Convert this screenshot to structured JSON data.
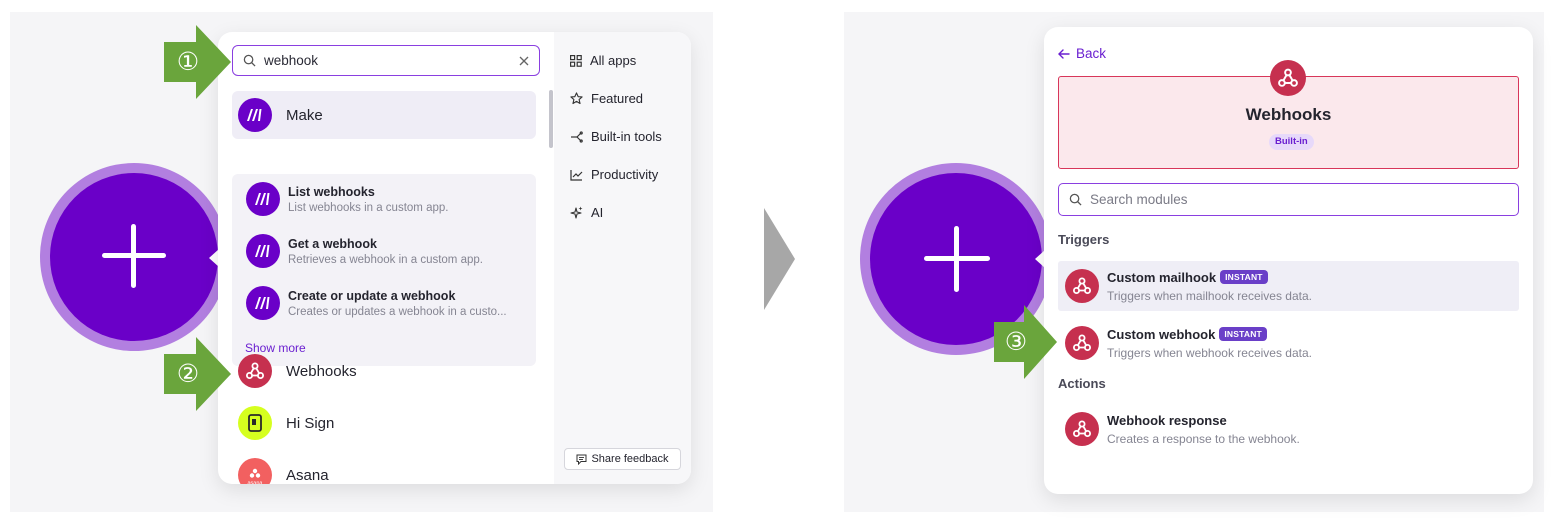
{
  "left": {
    "search": {
      "value": "webhook",
      "clear_icon": "close-icon"
    },
    "apps": [
      {
        "name": "Make",
        "icon": "make-logo-icon"
      },
      {
        "name": "Webhooks",
        "icon": "webhook-icon"
      },
      {
        "name": "Hi Sign",
        "icon": "hi-sign-logo-icon"
      },
      {
        "name": "Asana",
        "icon": "asana-logo-icon",
        "logo_text": "asana"
      }
    ],
    "make_modules": [
      {
        "title": "List webhooks",
        "desc": "List webhooks in a custom app."
      },
      {
        "title": "Get a webhook",
        "desc": "Retrieves a webhook in a custom app."
      },
      {
        "title": "Create or update a webhook",
        "desc": "Creates or updates a webhook in a custo..."
      }
    ],
    "show_more": "Show more",
    "sidebar": [
      {
        "label": "All apps",
        "icon": "grid-icon"
      },
      {
        "label": "Featured",
        "icon": "star-icon"
      },
      {
        "label": "Built-in tools",
        "icon": "tools-icon"
      },
      {
        "label": "Productivity",
        "icon": "chart-icon"
      },
      {
        "label": "AI",
        "icon": "sparkle-icon"
      }
    ],
    "feedback": "Share feedback"
  },
  "callouts": [
    "①",
    "②",
    "③"
  ],
  "right": {
    "back": "Back",
    "app_title": "Webhooks",
    "app_badge": "Built-in",
    "search_placeholder": "Search modules",
    "triggers_heading": "Triggers",
    "actions_heading": "Actions",
    "triggers": [
      {
        "title": "Custom mailhook",
        "badge": "INSTANT",
        "desc": "Triggers when mailhook receives data."
      },
      {
        "title": "Custom webhook",
        "badge": "INSTANT",
        "desc": "Triggers when webhook receives data."
      }
    ],
    "actions": [
      {
        "title": "Webhook response",
        "desc": "Creates a response to the webhook."
      }
    ]
  },
  "colors": {
    "accent": "#6a00c8",
    "webhook": "#c6304f",
    "callout": "#6aa53c",
    "badge": "#6a3fc8"
  }
}
